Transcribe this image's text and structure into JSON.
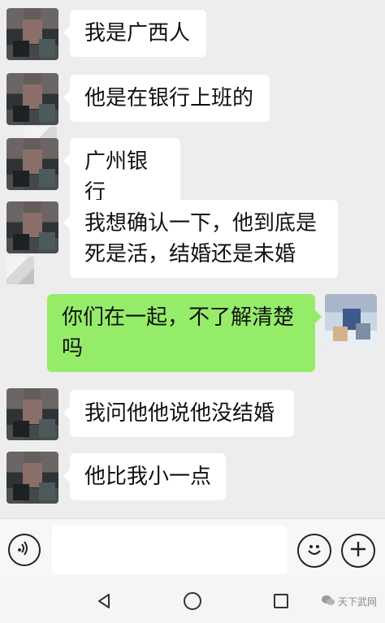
{
  "messages": [
    {
      "side": "left",
      "text": "我是广西人"
    },
    {
      "side": "left",
      "text": "他是在银行上班的"
    },
    {
      "side": "left",
      "text": "广州银行"
    },
    {
      "side": "left",
      "text": "我想确认一下，他到底是死是活，结婚还是未婚"
    },
    {
      "side": "right",
      "text": "你们在一起，不了解清楚吗"
    },
    {
      "side": "left",
      "text": "我问他他说他没结婚"
    },
    {
      "side": "left",
      "text": "他比我小一点"
    }
  ],
  "input": {
    "value": "",
    "placeholder": ""
  },
  "watermark": {
    "text": "天下武网"
  },
  "colors": {
    "chat_bg": "#ededed",
    "bubble_left": "#ffffff",
    "bubble_right": "#95ec69"
  },
  "icons": {
    "voice": "voice-icon",
    "emoji": "emoji-icon",
    "plus": "plus-icon",
    "back": "back-icon",
    "home": "home-icon",
    "recent": "recent-apps-icon"
  }
}
